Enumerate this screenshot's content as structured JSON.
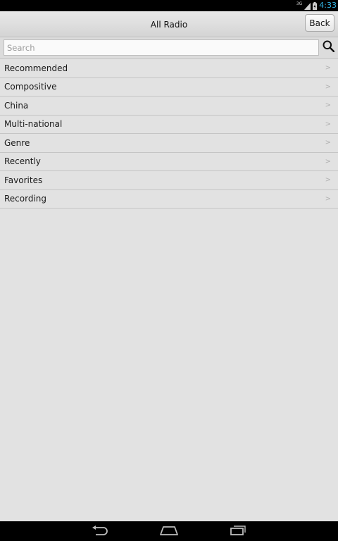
{
  "status_bar": {
    "network": "3G",
    "time": "4:33"
  },
  "header": {
    "title": "All Radio",
    "back_label": "Back"
  },
  "search": {
    "placeholder": "Search",
    "value": ""
  },
  "menu": {
    "items": [
      {
        "label": "Recommended",
        "chevron": ">"
      },
      {
        "label": "Compositive",
        "chevron": ">"
      },
      {
        "label": "China",
        "chevron": ">"
      },
      {
        "label": "Multi-national",
        "chevron": ">"
      },
      {
        "label": "Genre",
        "chevron": ">"
      },
      {
        "label": "Recently",
        "chevron": ">"
      },
      {
        "label": "Favorites",
        "chevron": ">"
      },
      {
        "label": "Recording",
        "chevron": ">"
      }
    ]
  },
  "nav": {
    "icons": [
      "back-icon",
      "home-icon",
      "recent-apps-icon"
    ]
  },
  "colors": {
    "background": "#e2e2e2",
    "status_time": "#33b5e5",
    "divider": "#c5c5c5"
  }
}
